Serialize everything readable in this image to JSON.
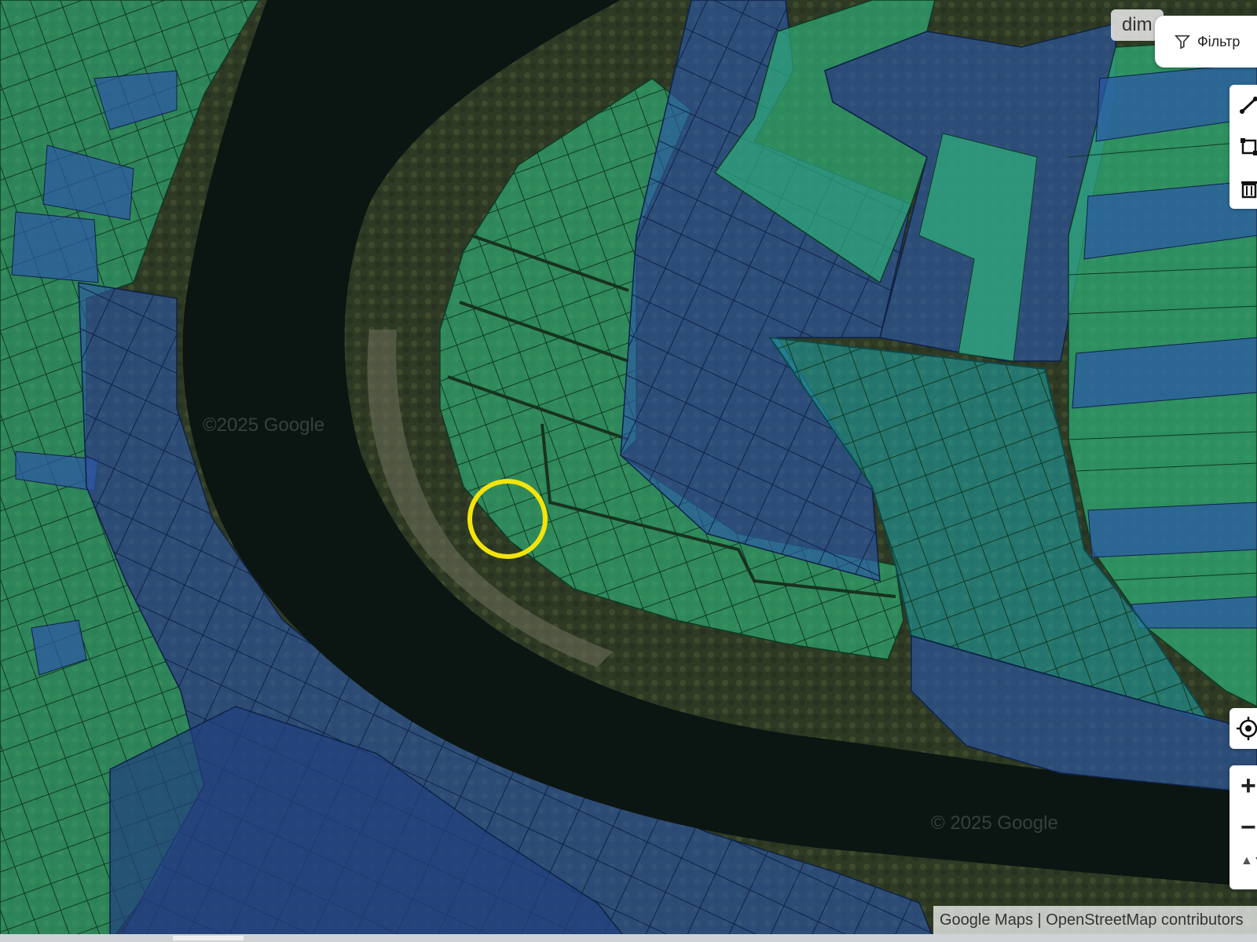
{
  "top_chip": {
    "text": "dim"
  },
  "filter": {
    "label": "Фільтр",
    "icon": "filter-icon"
  },
  "tools": [
    {
      "name": "draw-line-icon"
    },
    {
      "name": "draw-polygon-icon"
    },
    {
      "name": "trash-icon"
    }
  ],
  "locate": {
    "icon": "locate-icon"
  },
  "zoom": {
    "in_label": "+",
    "out_label": "−",
    "compass_label": "▲▼"
  },
  "attribution": {
    "text": "Google Maps | OpenStreetMap contributors"
  },
  "watermarks": [
    "©2025 Google",
    "© 2025 Google"
  ],
  "colors": {
    "river": "#0b1512",
    "parcel_green": "#2fb37a",
    "parcel_blue": "#2d57a8",
    "parcel_teal": "#1f9fa0",
    "highlight_circle": "#f3e40a"
  }
}
